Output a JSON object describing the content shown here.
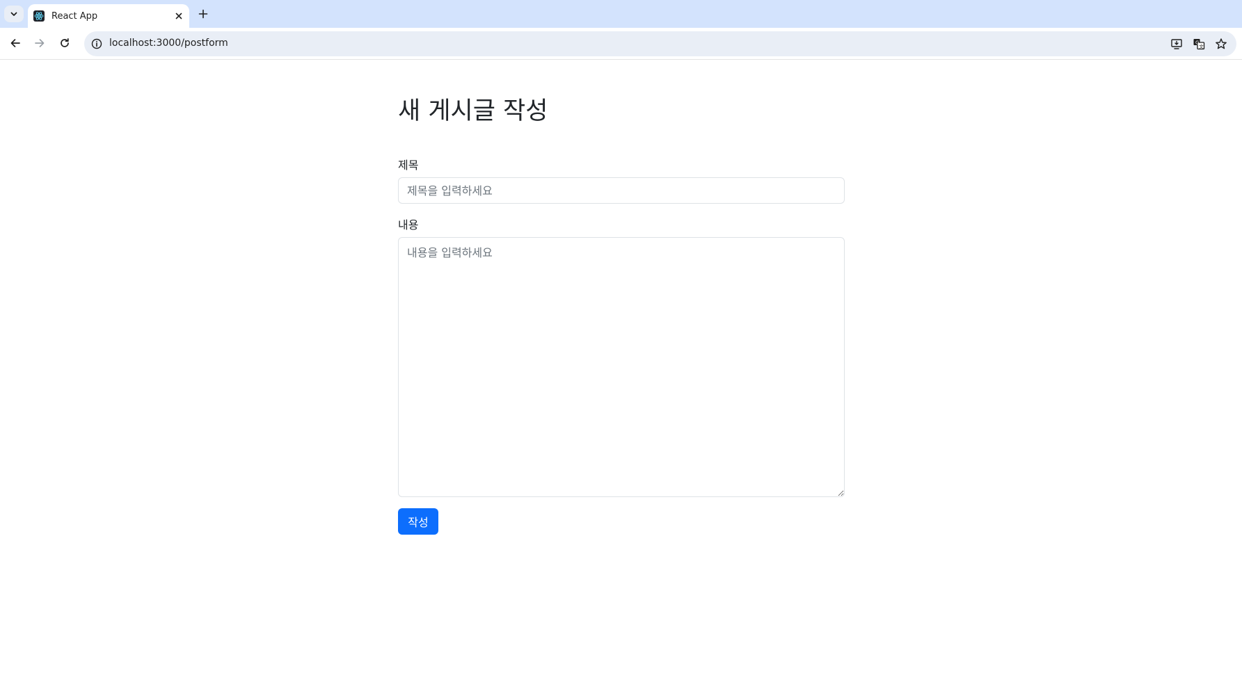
{
  "browser": {
    "tab": {
      "title": "React App",
      "favicon": "react-logo-icon",
      "close_icon": "close-icon"
    },
    "new_tab_icon": "plus-icon",
    "tab_search_icon": "chevron-down-icon",
    "nav": {
      "back_icon": "arrow-left-icon",
      "forward_icon": "arrow-right-icon",
      "reload_icon": "reload-icon"
    },
    "omnibox": {
      "url": "localhost:3000/postform",
      "site_info_icon": "info-icon",
      "right_icons": [
        "install-app-icon",
        "translate-icon",
        "star-icon"
      ]
    }
  },
  "page": {
    "title": "새 게시글 작성",
    "fields": {
      "title_label": "제목",
      "title_placeholder": "제목을 입력하세요",
      "title_value": "",
      "content_label": "내용",
      "content_placeholder": "내용을 입력하세요",
      "content_value": ""
    },
    "submit_label": "작성"
  },
  "colors": {
    "chrome_tabstrip": "#d3e3fd",
    "omnibox_bg": "#e9eef6",
    "primary_button": "#0d6efd",
    "text": "#212529",
    "placeholder": "#6c757d",
    "input_border": "#dee2e6"
  }
}
